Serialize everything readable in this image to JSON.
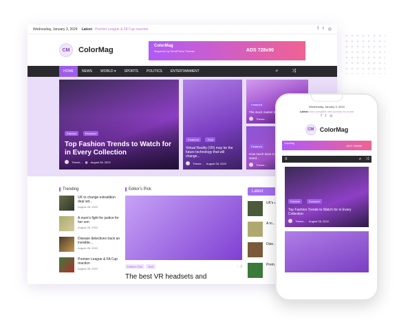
{
  "topbar": {
    "date": "Wednesday, January 3, 2024",
    "latest_label": "Latest:",
    "ticker": "Premier League & FA Cup reaction"
  },
  "site": {
    "logo_initials": "CM",
    "name": "ColorMag"
  },
  "ad": {
    "name": "ColorMag",
    "sub": "Magazine by WordPress Themes",
    "size": "ADS 728x90"
  },
  "nav": {
    "items": [
      "HOME",
      "NEWS",
      "WORLD ▾",
      "SPORTS",
      "POLITICS",
      "ENTERTAINMENT"
    ]
  },
  "hero": {
    "main": {
      "tags": [
        "Fashion",
        "Featured"
      ],
      "title": "Top Fashion Trends to Watch for in Every Collection",
      "author": "Theme...",
      "date": "August 28, 2022"
    },
    "mid": {
      "tags": [
        "Featured",
        "Tech"
      ],
      "title": "Virtual Reality (VR) may be the future technology that will change...",
      "author": "Theme...",
      "date": "August 28, 2022"
    },
    "right1": {
      "tags": [
        "Featured"
      ],
      "title": "The stock market trends to watch for...",
      "author": "Theme..."
    },
    "right2": {
      "tags": [
        "Featured"
      ],
      "title": "How much does it cost to get into a stand...",
      "author": "Theme..."
    }
  },
  "trending": {
    "heading": "Trending",
    "items": [
      {
        "title": "UK to change extradition deal wit...",
        "date": "August 28, 2022"
      },
      {
        "title": "A mum's fight for justice for her son",
        "date": "August 28, 2022"
      },
      {
        "title": "Disease detectives track an invisible...",
        "date": "August 28, 2022"
      },
      {
        "title": "Premier League & FA Cup reaction",
        "date": "August 28, 2022"
      }
    ]
  },
  "editors": {
    "heading": "Editor's Pick",
    "tags": [
      "Editor's Pick",
      "Tech"
    ],
    "title": "The best VR headsets and",
    "comments": "2"
  },
  "latest": {
    "heading": "Latest",
    "items": [
      "UK's wit...",
      "A m... for h...",
      "Dise... track...",
      "Prem... FA C..."
    ]
  },
  "phone": {
    "date": "Wednesday, January 3, 2024",
    "latest_label": "Latest:",
    "ticker": "Bon complete new journey for home",
    "ad_name": "ColorMag",
    "ad_size": "ADS 728x90",
    "card": {
      "tags": [
        "Fashion",
        "Featured"
      ],
      "title": "Top Fashion Trends to Watch for in Every Collection",
      "author": "Theme...",
      "date": "August 28, 2022"
    }
  },
  "colors": {
    "accent": "#9d5de8",
    "nav_bg": "#2a2a2e",
    "hero_bg": "#e9ddfa"
  }
}
